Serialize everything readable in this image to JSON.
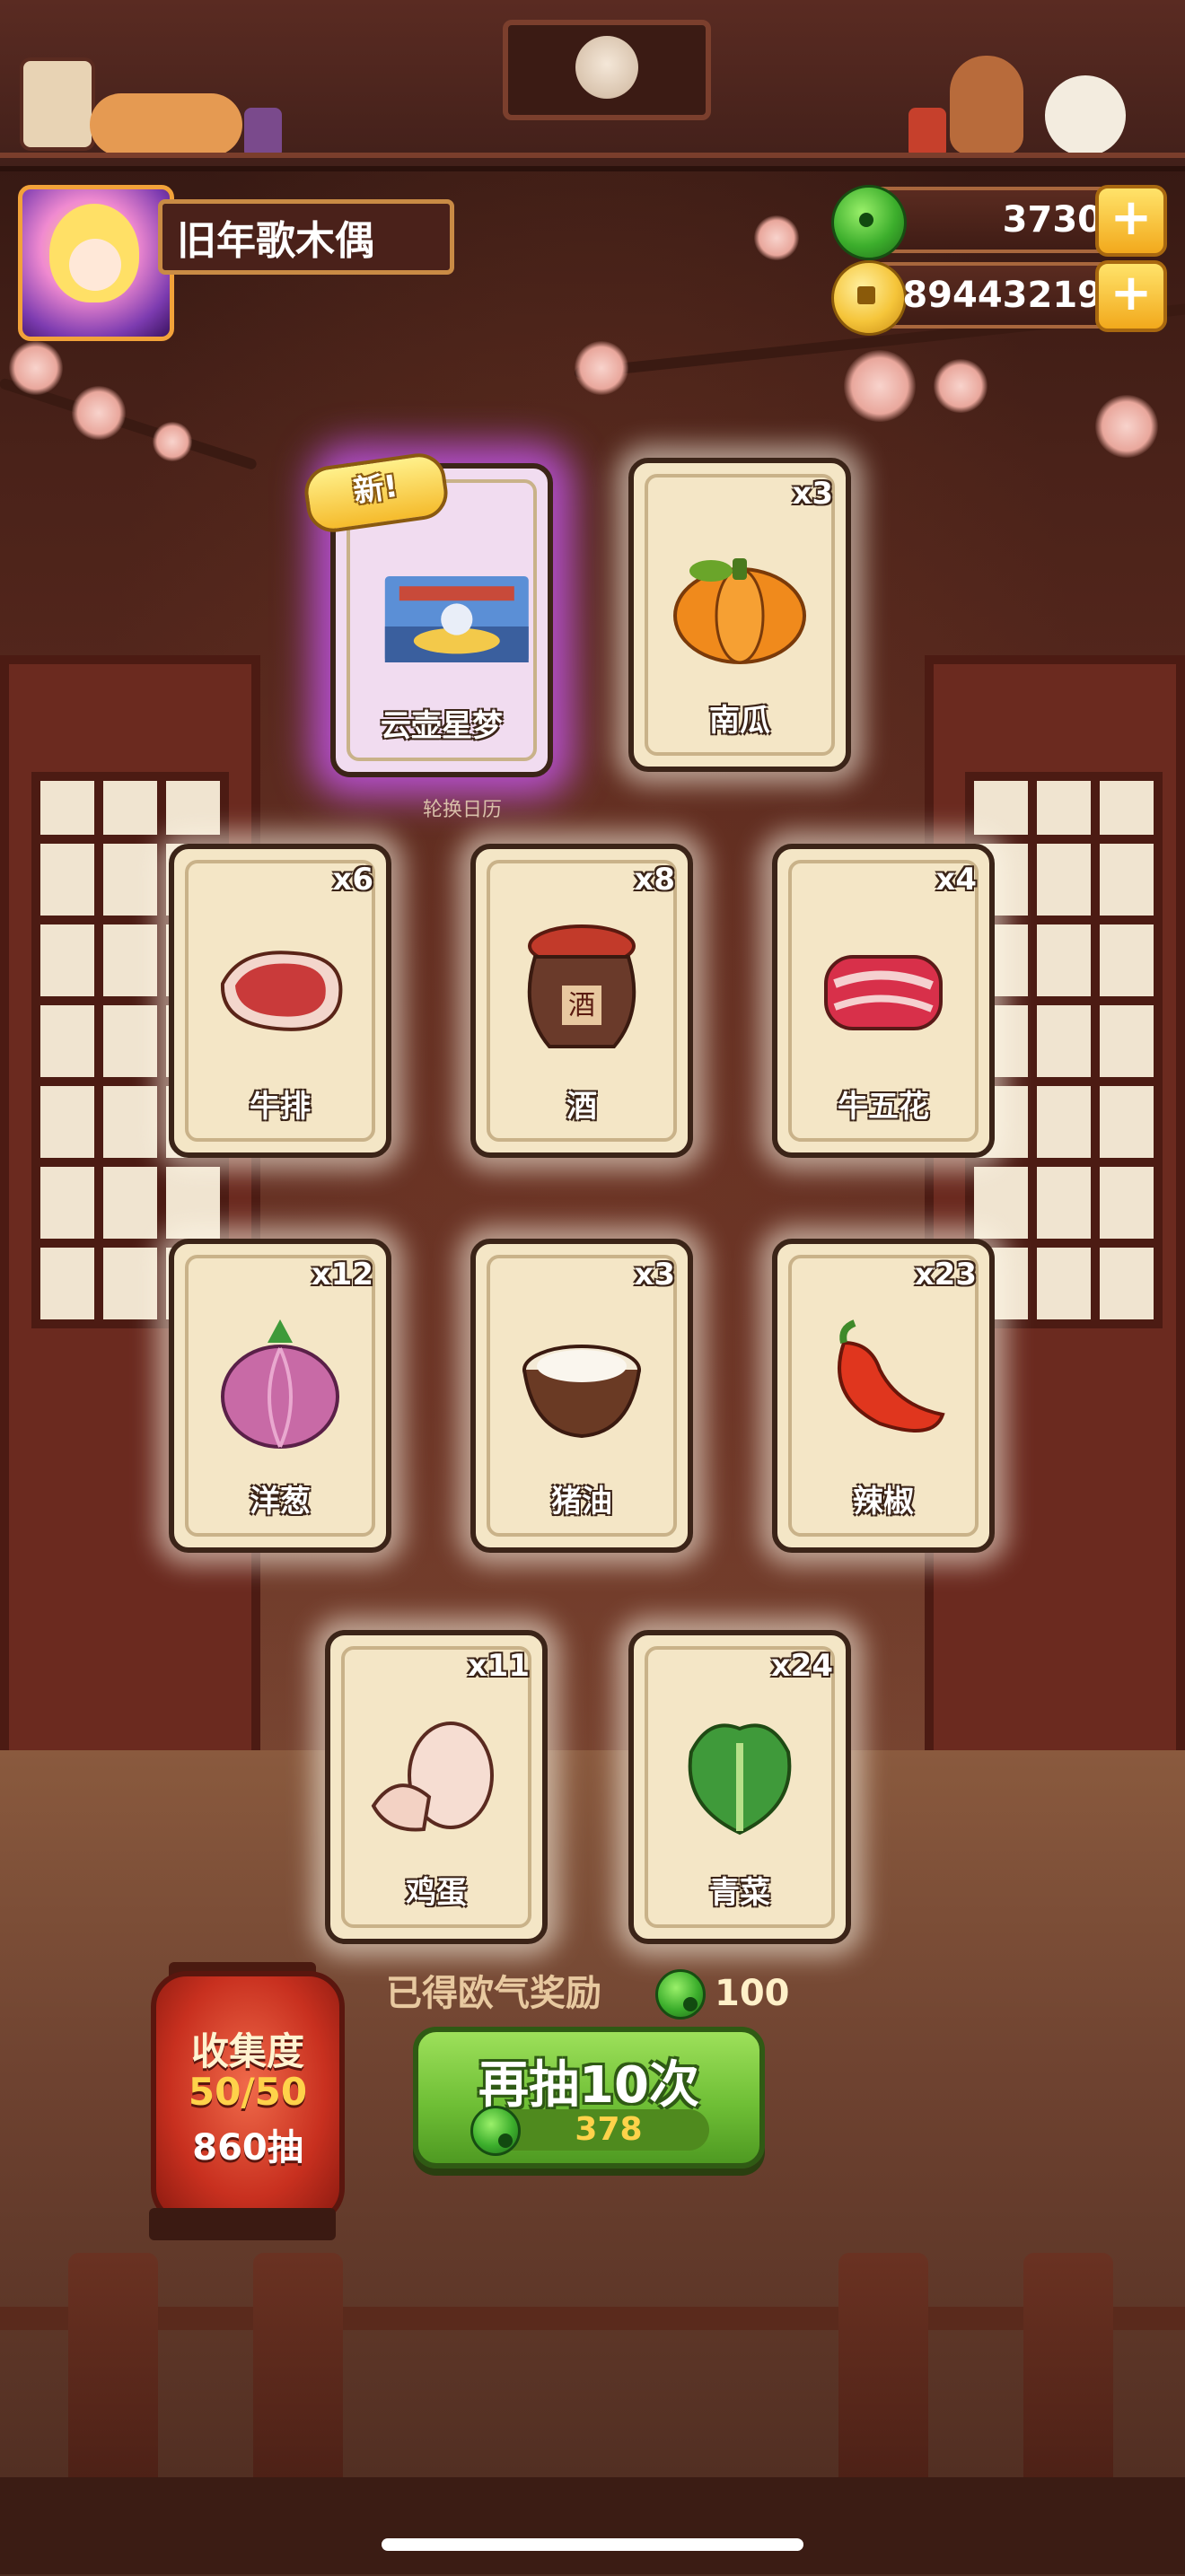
{
  "player": {
    "name": "旧年歌木偶"
  },
  "currencies": {
    "jade": "3730",
    "coins": "89443219"
  },
  "under_card_label": "轮换日历",
  "cards": [
    {
      "name": "云壶星梦",
      "count": "",
      "is_new": true,
      "new_label": "新!"
    },
    {
      "name": "南瓜",
      "count": "x3"
    },
    {
      "name": "牛排",
      "count": "x6"
    },
    {
      "name": "酒",
      "count": "x8"
    },
    {
      "name": "牛五花",
      "count": "x4"
    },
    {
      "name": "洋葱",
      "count": "x12"
    },
    {
      "name": "猪油",
      "count": "x3"
    },
    {
      "name": "辣椒",
      "count": "x23"
    },
    {
      "name": "鸡蛋",
      "count": "x11"
    },
    {
      "name": "青菜",
      "count": "x24"
    }
  ],
  "jar_label": "酒",
  "luck_reward": {
    "label": "已得欧气奖励",
    "amount": "100"
  },
  "redraw": {
    "label": "再抽10次",
    "cost": "378"
  },
  "collection": {
    "title": "收集度",
    "progress": "50/50",
    "draws": "860抽"
  },
  "colors": {
    "accent_green": "#6fbf36",
    "special_glow": "#cd5aff",
    "gold": "#f5c53a"
  }
}
